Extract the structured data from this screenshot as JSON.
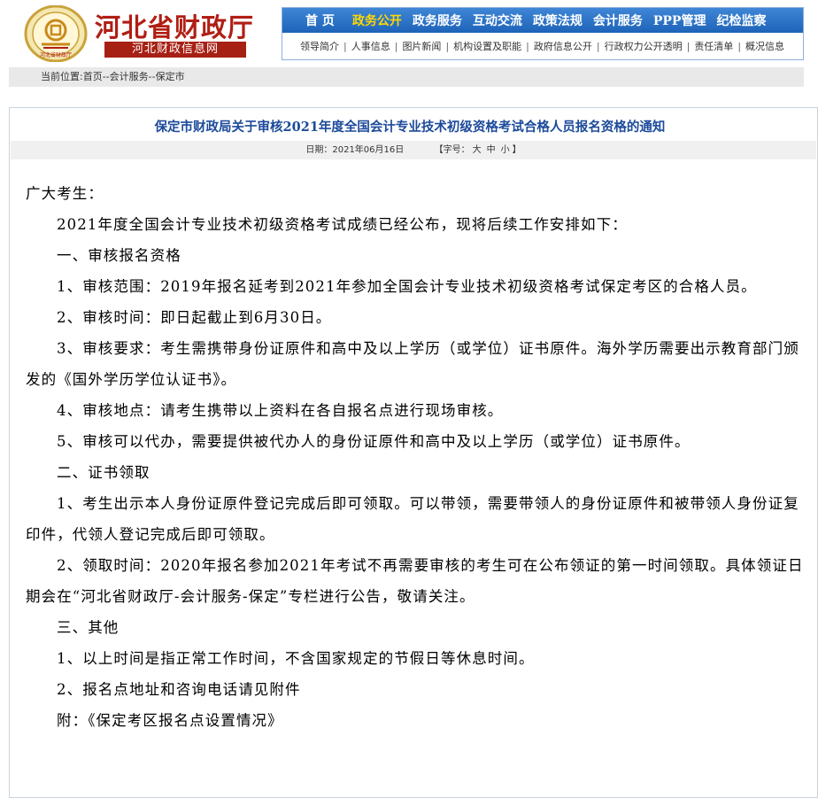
{
  "header": {
    "site_title": "河北省财政厅",
    "site_subtitle": "河北财政信息网",
    "emblem_text": "河北省财政厅"
  },
  "nav": {
    "main": [
      {
        "label": "首  页",
        "active": false
      },
      {
        "label": "政务公开",
        "active": true
      },
      {
        "label": "政务服务",
        "active": false
      },
      {
        "label": "互动交流",
        "active": false
      },
      {
        "label": "政策法规",
        "active": false
      },
      {
        "label": "会计服务",
        "active": false
      },
      {
        "label": "PPP管理",
        "active": false
      },
      {
        "label": "纪检监察",
        "active": false
      }
    ],
    "sub": [
      "领导简介",
      "人事信息",
      "图片新闻",
      "机构设置及职能",
      "政府信息公开",
      "行政权力公开透明",
      "责任清单",
      "概况信息"
    ]
  },
  "breadcrumb": "当前位置:首页--会计服务--保定市",
  "article": {
    "title": "保定市财政局关于审核2021年度全国会计专业技术初级资格考试合格人员报名资格的通知",
    "date_label": "日期：2021年06月16日",
    "font_size_label": "【字号：",
    "font_sizes": [
      "大",
      "中",
      "小"
    ],
    "font_size_close": "】",
    "paragraphs": [
      {
        "text": "广大考生：",
        "indent": false
      },
      {
        "text": "2021年度全国会计专业技术初级资格考试成绩已经公布，现将后续工作安排如下：",
        "indent": true
      },
      {
        "text": "一、审核报名资格",
        "indent": true
      },
      {
        "text": "1、审核范围：2019年报名延考到2021年参加全国会计专业技术初级资格考试保定考区的合格人员。",
        "indent": true
      },
      {
        "text": "2、审核时间：即日起截止到6月30日。",
        "indent": true
      },
      {
        "text": "3、审核要求：考生需携带身份证原件和高中及以上学历（或学位）证书原件。海外学历需要出示教育部门颁发的《国外学历学位认证书》。",
        "indent": true
      },
      {
        "text": "4、审核地点：请考生携带以上资料在各自报名点进行现场审核。",
        "indent": true
      },
      {
        "text": "5、审核可以代办，需要提供被代办人的身份证原件和高中及以上学历（或学位）证书原件。",
        "indent": true
      },
      {
        "text": "二、证书领取",
        "indent": true
      },
      {
        "text": "1、考生出示本人身份证原件登记完成后即可领取。可以带领，需要带领人的身份证原件和被带领人身份证复印件，代领人登记完成后即可领取。",
        "indent": true
      },
      {
        "text": "2、领取时间：2020年报名参加2021年考试不再需要审核的考生可在公布领证的第一时间领取。具体领证日期会在“河北省财政厅-会计服务-保定”专栏进行公告，敬请关注。",
        "indent": true
      },
      {
        "text": "三、其他",
        "indent": true
      },
      {
        "text": "1、以上时间是指正常工作时间，不含国家规定的节假日等休息时间。",
        "indent": true
      },
      {
        "text": "2、报名点地址和咨询电话请见附件",
        "indent": true
      },
      {
        "text": "附：《保定考区报名点设置情况》",
        "indent": true
      }
    ]
  },
  "colors": {
    "brand_red": "#b01e14",
    "nav_blue": "#2a72c8",
    "nav_active": "#ffd800",
    "title_blue": "#1c4a9b"
  }
}
